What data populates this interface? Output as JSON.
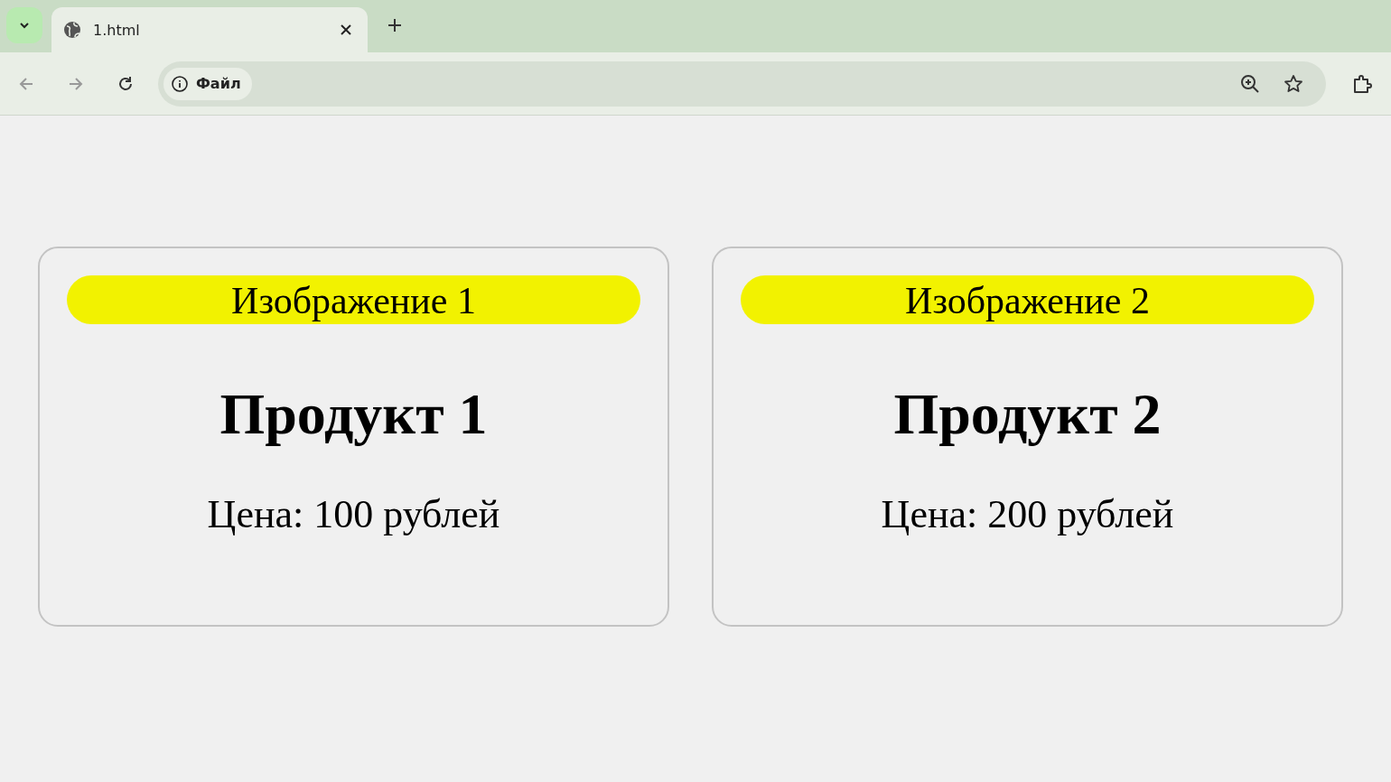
{
  "browser": {
    "tabs": [
      {
        "title": "1.html",
        "selected": true
      }
    ],
    "address": {
      "chip": "Файл"
    }
  },
  "products": [
    {
      "image_label": "Изображение 1",
      "name": "Продукт 1",
      "price": "Цена: 100 рублей"
    },
    {
      "image_label": "Изображение 2",
      "name": "Продукт 2",
      "price": "Цена: 200 рублей"
    }
  ]
}
